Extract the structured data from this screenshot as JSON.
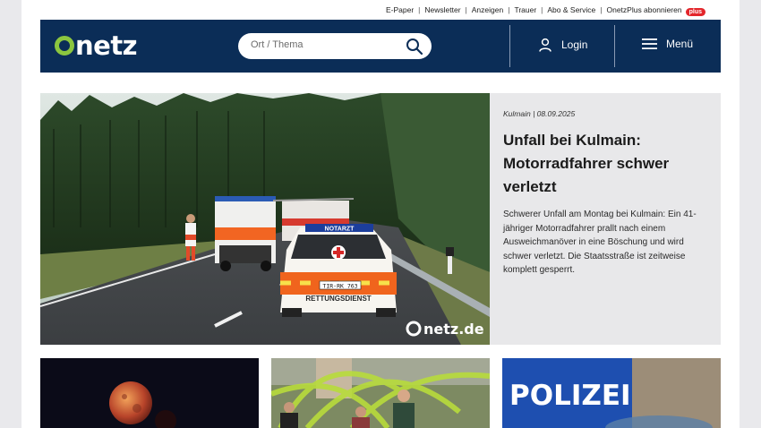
{
  "top_links": [
    "E-Paper",
    "Newsletter",
    "Anzeigen",
    "Trauer",
    "Abo & Service",
    "OnetzPlus abonnieren"
  ],
  "plus_badge": "plus",
  "header": {
    "logo_text": "netz",
    "search_placeholder": "Ort / Thema",
    "login_label": "Login",
    "menu_label": "Menü"
  },
  "hero": {
    "meta": "Kulmain | 08.09.2025",
    "title": "Unfall bei Kulmain: Motorradfahrer schwer verletzt",
    "teaser": "Schwerer Unfall am Montag bei Kulmain: Ein 41-jähriger Motorradfahrer prallt nach einem Ausweichmanöver in eine Böschung und wird schwer verletzt. Die Staatsstraße ist zeitweise komplett gesperrt.",
    "image": {
      "watermark": "netz.de",
      "ambulance_sign": "RETTUNGSDIENST",
      "notarzt_sign": "NOTARZT",
      "plate": "TIR-RK 763"
    }
  },
  "cards": [
    {
      "name": "card-moon"
    },
    {
      "name": "card-fest"
    },
    {
      "name": "card-polizei",
      "sign": "POLIZEI"
    }
  ],
  "colors": {
    "header_bg": "#0b2d57",
    "logo_green": "#8cc63f",
    "plus_red": "#e3262b",
    "hero_text_bg": "#e8e8ea"
  },
  "icons": [
    "search-icon",
    "user-icon",
    "hamburger-menu-icon"
  ]
}
